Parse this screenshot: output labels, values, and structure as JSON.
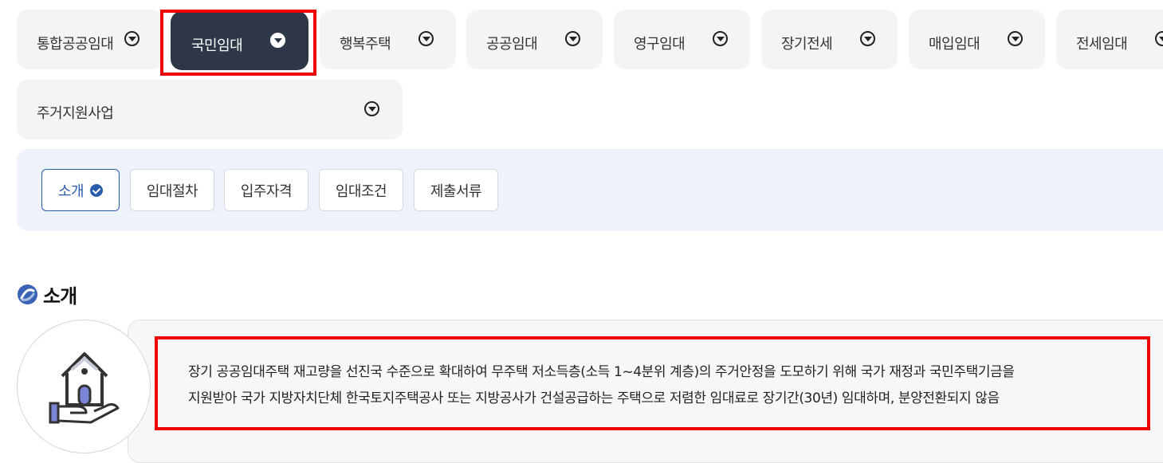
{
  "main_tabs": [
    {
      "label": "통합공공임대"
    },
    {
      "label": "국민임대"
    },
    {
      "label": "행복주택"
    },
    {
      "label": "공공임대"
    },
    {
      "label": "영구임대"
    },
    {
      "label": "장기전세"
    },
    {
      "label": "매입임대"
    },
    {
      "label": "전세임대"
    },
    {
      "label": "주거지원사업"
    }
  ],
  "active_tab": "국민임대",
  "sub_tabs": [
    {
      "label": "소개"
    },
    {
      "label": "임대절차"
    },
    {
      "label": "입주자격"
    },
    {
      "label": "임대조건"
    },
    {
      "label": "제출서류"
    }
  ],
  "active_sub_tab": "소개",
  "section": {
    "title": "소개",
    "description_line1": "장기 공공임대주택 재고량을 선진국 수준으로 확대하여 무주택 저소득층(소득 1~4분위 계층)의 주거안정을 도모하기 위해 국가 재정과 국민주택기금을",
    "description_line2": "지원받아 국가 지방자치단체 한국토지주택공사 또는 지방공사가 건설공급하는 주택으로 저렴한 임대료로 장기간(30년) 임대하며, 분양전환되지 않음"
  },
  "colors": {
    "active_tab_bg": "#2d3748",
    "highlight": "#ee0000",
    "accent_blue": "#2a5cad",
    "subnav_bg": "#eef3fb"
  }
}
